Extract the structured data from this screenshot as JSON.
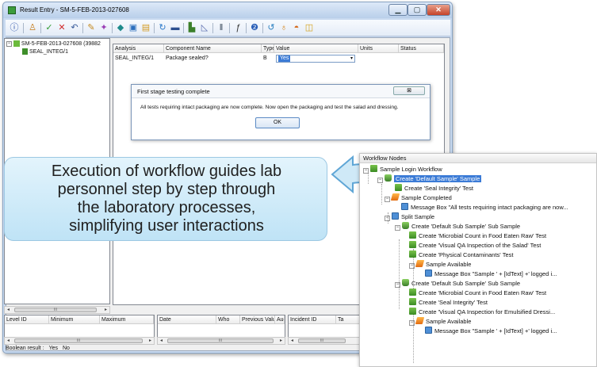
{
  "window": {
    "title": "Result Entry - SM-5-FEB-2013-027608"
  },
  "toolbar_icons": [
    "info-icon",
    "user-icon",
    "check-icon",
    "cross-icon",
    "undo-icon",
    "pen-icon",
    "wand-icon",
    "diamond-icon",
    "pin-icon",
    "folder-icon",
    "refresh-icon",
    "card-icon",
    "chart-icon",
    "graph-icon",
    "filter-icon",
    "function-icon",
    "help-icon",
    "cycle-icon",
    "flask-icon",
    "bucket-icon",
    "folder-open-icon"
  ],
  "tree": {
    "root": "SM-5-FEB-2013-027608 (39882",
    "child": "SEAL_INTEG/1"
  },
  "grid_main": {
    "headers": [
      "Analysis",
      "Component Name",
      "Type",
      "Value",
      "Units",
      "Status"
    ],
    "row": [
      "SEAL_INTEG/1",
      "Package sealed?",
      "B",
      "Yes",
      "",
      ""
    ]
  },
  "dialog": {
    "title": "First stage testing complete",
    "close_label": "⊠",
    "message": "All tests requiring intact packaging are now complete.  Now open the packaging and test the salad and dressing.",
    "ok_label": "OK"
  },
  "callout": {
    "lines": [
      "Execution of workflow guides lab",
      "personnel step by step through",
      "the laboratory processes,",
      "simplifying user interactions"
    ]
  },
  "grid_bottom_left": {
    "headers": [
      "Level ID",
      "Minimum",
      "Maximum"
    ]
  },
  "grid_bottom_mid": {
    "headers": [
      "Date",
      "Who",
      "Previous Value",
      "Aud"
    ]
  },
  "grid_bottom_right": {
    "headers": [
      "Incident ID",
      "Ta"
    ]
  },
  "boolean_result": {
    "label": "Boolean result :",
    "yes": "Yes",
    "no": "No"
  },
  "workflow": {
    "title": "Workflow Nodes",
    "nodes": [
      "Sample Login Workflow",
      "Create 'Default Sample' Sample",
      "Create 'Seal Integrity' Test",
      "Sample Completed",
      "Message Box \"All tests requiring intact packaging are now...",
      "Split Sample",
      "Create 'Default Sub Sample' Sub Sample",
      "Create 'Microbial Count in Food Eaten Raw' Test",
      "Create 'Visual QA Inspection of the Salad' Test",
      "Create 'Physical Contaminants' Test",
      "Sample Available",
      "Message Box \"Sample ' + [IdText]  +' logged i...",
      "Create 'Default Sub Sample' Sub Sample",
      "Create 'Microbial Count in Food Eaten Raw' Test",
      "Create 'Seal Integrity' Test",
      "Create 'Visual QA Inspection for Emulsified Dressi...",
      "Sample Available",
      "Message Box \"Sample ' + [IdText]  +' logged i..."
    ]
  },
  "scroll_thumb_label": "III",
  "colors": {
    "selection": "#3b7bd6",
    "callout_fill": "#c9e8f8",
    "window_frame": "#c9daf0"
  }
}
